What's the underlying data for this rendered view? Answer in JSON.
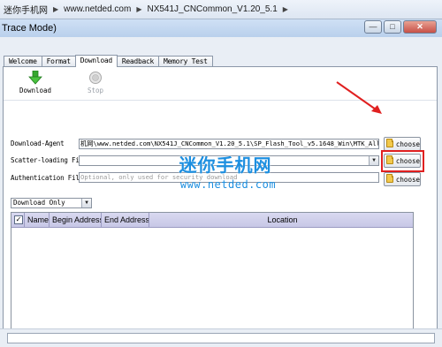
{
  "breadcrumb": [
    "迷你手机网",
    "www.netded.com",
    "NX541J_CNCommon_V1.20_5.1"
  ],
  "window": {
    "title": "Trace Mode)"
  },
  "tabs": [
    "Welcome",
    "Format",
    "Download",
    "Readback",
    "Memory Test"
  ],
  "active_tab": "Download",
  "toolbar": {
    "download_label": "Download",
    "stop_label": "Stop"
  },
  "form": {
    "download_agent_label": "Download-Agent",
    "download_agent_value": "机网\\www.netded.com\\NX541J_CNCommon_V1.20_5.1\\SP_Flash_Tool_v5.1648_Win\\MTK_AllInOne_DA.bin",
    "scatter_label": "Scatter-loading File",
    "scatter_value": "",
    "auth_label": "Authentication File",
    "auth_placeholder": "Optional, only used for security download",
    "choose_label": "choose"
  },
  "mode_select": {
    "selected": "Download Only"
  },
  "table": {
    "columns": [
      "Name",
      "Begin Address",
      "End Address",
      "Location"
    ],
    "rows": []
  },
  "watermark": {
    "title": "迷你手机网",
    "url": "www.netded.com"
  },
  "colors": {
    "accent": "#1d8fe0",
    "highlight": "#e02020",
    "header": "#c7c7e6"
  },
  "icons": {
    "download": "green-down-arrow-icon",
    "stop": "stop-circle-icon",
    "folder": "folder-icon"
  }
}
